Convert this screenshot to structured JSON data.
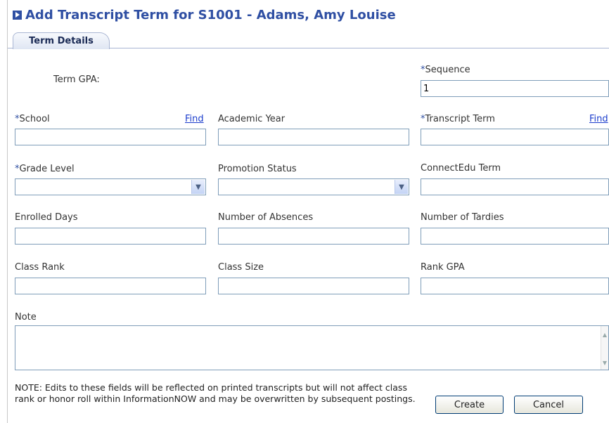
{
  "window": {
    "title": "Add Transcript Term for S1001 - Adams, Amy Louise"
  },
  "tabs": [
    {
      "label": "Term Details",
      "active": true
    }
  ],
  "form": {
    "term_gpa_label": "Term GPA:",
    "sequence": {
      "required_mark": "*",
      "label": "Sequence",
      "value": "1"
    },
    "school": {
      "required_mark": "*",
      "label": "School",
      "value": "",
      "find_label": "Find"
    },
    "academic_year": {
      "label": "Academic Year",
      "value": ""
    },
    "transcript_term": {
      "required_mark": "*",
      "label": "Transcript Term",
      "value": "",
      "find_label": "Find"
    },
    "grade_level": {
      "required_mark": "*",
      "label": "Grade Level",
      "value": ""
    },
    "promotion_status": {
      "label": "Promotion Status",
      "value": ""
    },
    "connectedu_term": {
      "label": "ConnectEdu Term",
      "value": ""
    },
    "enrolled_days": {
      "label": "Enrolled Days",
      "value": ""
    },
    "number_of_absences": {
      "label": "Number of Absences",
      "value": ""
    },
    "number_of_tardies": {
      "label": "Number of Tardies",
      "value": ""
    },
    "class_rank": {
      "label": "Class Rank",
      "value": ""
    },
    "class_size": {
      "label": "Class Size",
      "value": ""
    },
    "rank_gpa": {
      "label": "Rank GPA",
      "value": ""
    },
    "note": {
      "label": "Note",
      "value": ""
    }
  },
  "footer": {
    "note_text": "NOTE: Edits to these fields will be reflected on printed transcripts but will not affect class rank or honor roll within InformationNOW and may be overwritten by subsequent postings.",
    "create_label": "Create",
    "cancel_label": "Cancel"
  },
  "colors": {
    "title": "#2f4fa3",
    "required_mark": "#2f4fa3",
    "link": "#1a3ccc",
    "input_border": "#7f9db9"
  }
}
